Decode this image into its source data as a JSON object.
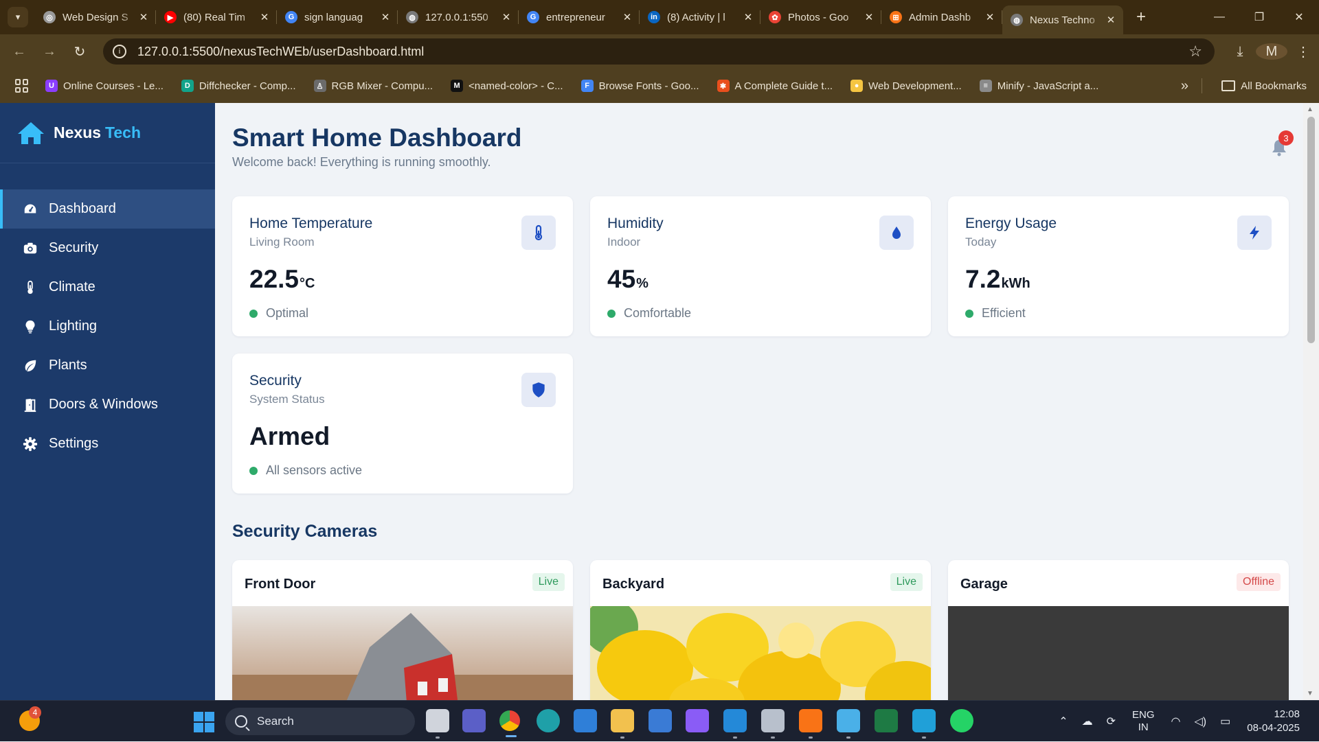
{
  "browser": {
    "tabs": [
      {
        "title": "Web Design S",
        "color": "#9a9a9a",
        "glyph": "◎"
      },
      {
        "title": "(80) Real Tim",
        "color": "#ff0000",
        "glyph": "▶"
      },
      {
        "title": "sign languag",
        "color": "#4285f4",
        "glyph": "G"
      },
      {
        "title": "127.0.0.1:550",
        "color": "#7a7a7a",
        "glyph": "◍"
      },
      {
        "title": "entrepreneur",
        "color": "#4285f4",
        "glyph": "G"
      },
      {
        "title": "(8) Activity | l",
        "color": "#0a66c2",
        "glyph": "in"
      },
      {
        "title": "Photos - Goo",
        "color": "#ea4335",
        "glyph": "✿"
      },
      {
        "title": "Admin Dashb",
        "color": "#f97316",
        "glyph": "⊞"
      },
      {
        "title": "Nexus Techno",
        "color": "#7a7a7a",
        "glyph": "◍"
      }
    ],
    "new_tab": "+",
    "url": "127.0.0.1:5500/nexusTechWEb/userDashboard.html",
    "profile_initial": "M",
    "bookmarks": [
      {
        "label": "Online Courses - Le...",
        "color": "#8b3dff",
        "glyph": "U"
      },
      {
        "label": "Diffchecker - Comp...",
        "color": "#12a38a",
        "glyph": "D"
      },
      {
        "label": "RGB Mixer - Compu...",
        "color": "#6b6b6b",
        "glyph": "♙"
      },
      {
        "label": "<named-color> - C...",
        "color": "#111111",
        "glyph": "M"
      },
      {
        "label": "Browse Fonts - Goo...",
        "color": "#4285f4",
        "glyph": "F"
      },
      {
        "label": "A Complete Guide t...",
        "color": "#e94f1d",
        "glyph": "✱"
      },
      {
        "label": "Web Development...",
        "color": "#f5c542",
        "glyph": "●"
      },
      {
        "label": "Minify - JavaScript a...",
        "color": "#8a8a8a",
        "glyph": "≡"
      }
    ],
    "all_bookmarks": "All Bookmarks"
  },
  "sidebar": {
    "brand_name": "Nexus",
    "brand_accent": "Tech",
    "items": [
      {
        "label": "Dashboard",
        "icon": "gauge-icon",
        "active": true
      },
      {
        "label": "Security",
        "icon": "camera-icon"
      },
      {
        "label": "Climate",
        "icon": "thermometer-icon"
      },
      {
        "label": "Lighting",
        "icon": "lightbulb-icon"
      },
      {
        "label": "Plants",
        "icon": "leaf-icon"
      },
      {
        "label": "Doors & Windows",
        "icon": "door-icon"
      },
      {
        "label": "Settings",
        "icon": "gear-icon"
      }
    ]
  },
  "header": {
    "title": "Smart Home Dashboard",
    "subtitle": "Welcome back! Everything is running smoothly.",
    "notifications": "3"
  },
  "cards": [
    {
      "title": "Home Temperature",
      "subtitle": "Living Room",
      "value": "22.5",
      "unit": "°C",
      "status": "Optimal",
      "icon": "thermometer-icon"
    },
    {
      "title": "Humidity",
      "subtitle": "Indoor",
      "value": "45",
      "unit": "%",
      "status": "Comfortable",
      "icon": "droplet-icon"
    },
    {
      "title": "Energy Usage",
      "subtitle": "Today",
      "value": "7.2",
      "unit": "kWh",
      "status": "Efficient",
      "icon": "bolt-icon"
    },
    {
      "title": "Security",
      "subtitle": "System Status",
      "value": "Armed",
      "unit": "",
      "status": "All sensors active",
      "icon": "shield-icon"
    }
  ],
  "cameras_title": "Security Cameras",
  "cameras": [
    {
      "name": "Front Door",
      "status": "Live"
    },
    {
      "name": "Backyard",
      "status": "Live"
    },
    {
      "name": "Garage",
      "status": "Offline"
    }
  ],
  "taskbar": {
    "search": "Search",
    "widget_badge": "4",
    "lang_top": "ENG",
    "lang_bottom": "IN",
    "time": "12:08",
    "date": "08-04-2025"
  },
  "colors": {
    "sidebar_bg": "#1c3a6a",
    "accent": "#38bdf8",
    "status_ok": "#2eaa6a",
    "title": "#173763"
  }
}
